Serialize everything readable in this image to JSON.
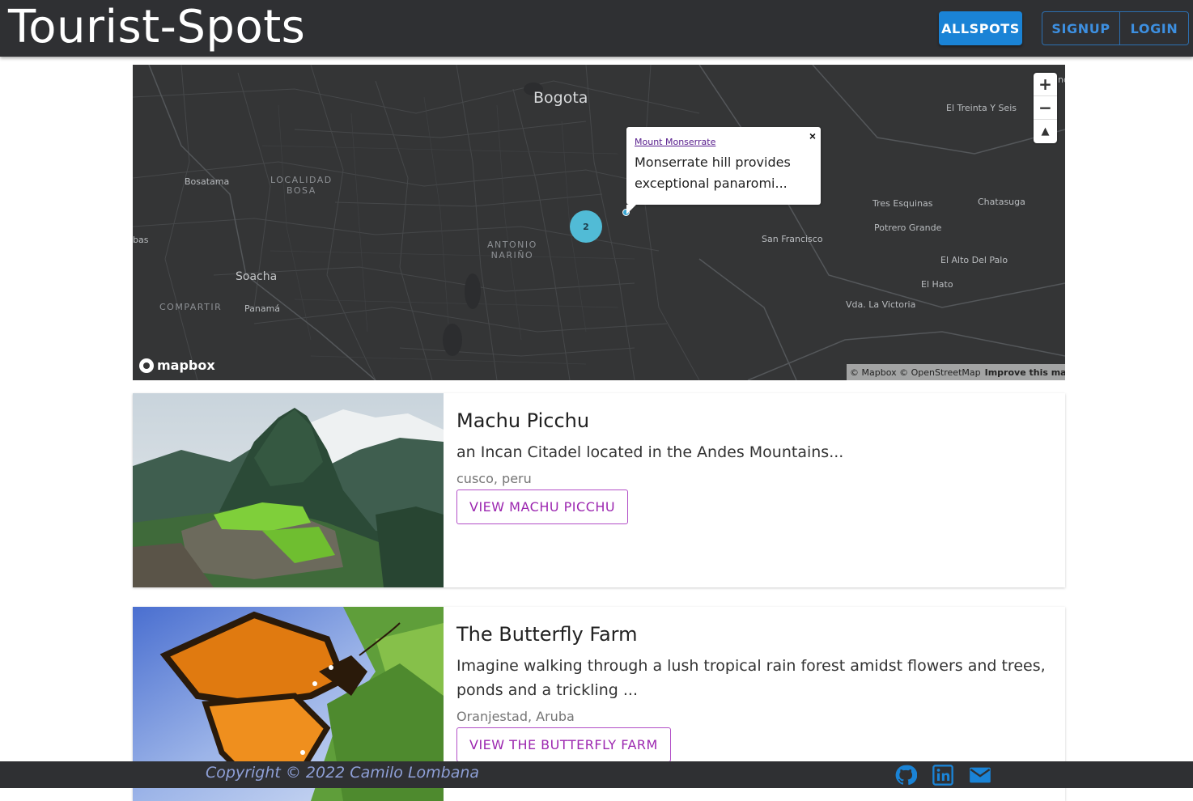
{
  "header": {
    "brand": "Tourist-Spots",
    "nav": {
      "allspots": "ALLSPOTS",
      "signup": "SIGNUP",
      "login": "LOGIN"
    }
  },
  "map": {
    "labels": {
      "bogota": "Bogota",
      "el_treinta": "El Treinta Y Seis",
      "bosatama": "Bosatama",
      "localidad": "LOCALIDAD",
      "bosa": "BOSA",
      "tres_esquinas": "Tres Esquinas",
      "chatasuga": "Chatasuga",
      "potrero": "Potrero Grande",
      "antonio": "ANTONIO",
      "narino": "NARIÑO",
      "san_francisco": "San Francisco",
      "el_alto": "El Alto Del Palo",
      "soacha": "Soacha",
      "el_hato": "El Hato",
      "compartir": "COMPARTIR",
      "panama": "Panamá",
      "vda": "Vda. La Victoria",
      "bas": "bas",
      "nd": "nd"
    },
    "zoom_in": "+",
    "zoom_out": "−",
    "compass": "▲",
    "cluster_count": "2",
    "popup": {
      "close": "×",
      "link": "Mount Monserrate",
      "text": "Monserrate hill provides exceptional panaromi..."
    },
    "logo": "mapbox",
    "attribution": "© Mapbox © OpenStreetMap",
    "improve": "Improve this map"
  },
  "spots": [
    {
      "title": "Machu Picchu",
      "description": "an Incan Citadel located in the Andes Mountains...",
      "location": "cusco, peru",
      "button": "VIEW MACHU PICCHU"
    },
    {
      "title": "The Butterfly Farm",
      "description": "Imagine walking through a lush tropical rain forest amidst flowers and trees, ponds and a trickling ...",
      "location": "Oranjestad, Aruba",
      "button": "VIEW THE BUTTERFLY FARM"
    }
  ],
  "footer": {
    "copyright": "Copyright © 2022 Camilo Lombana",
    "icons": [
      "github-icon",
      "linkedin-icon",
      "mail-icon"
    ],
    "icon_color": "#1a83d6"
  }
}
